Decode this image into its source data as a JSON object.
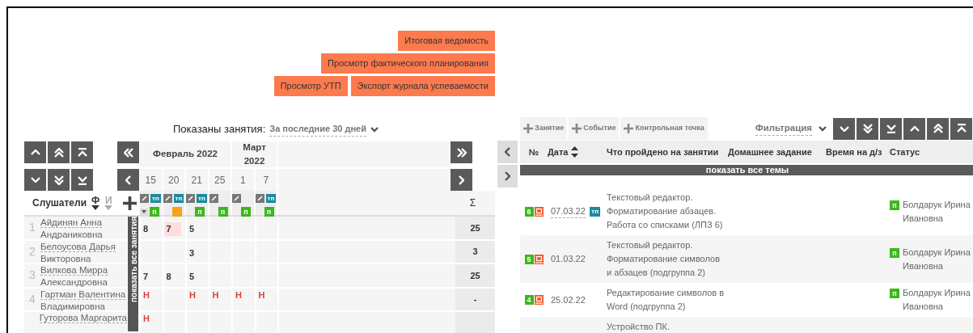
{
  "action_button_rows": [
    [
      "Итоговая ведомость"
    ],
    [
      "Просмотр фактического планирования"
    ],
    [
      "Просмотр УТП",
      "Экспорт журнала успеваемости"
    ]
  ],
  "journal": {
    "filter_label": "Показаны занятия:",
    "filter_value": "За последние 30 дней",
    "months": [
      {
        "label": "Февраль 2022",
        "days": [
          {
            "day": "15",
            "tp_badge": "тп",
            "lesson_type": {
              "kind": "practice",
              "label": "п"
            }
          },
          {
            "day": "20",
            "tp_badge": "тп",
            "lesson_type": {
              "kind": "event"
            }
          },
          {
            "day": "21",
            "tp_badge": "тп",
            "lesson_type": {
              "kind": "practice",
              "label": "п"
            }
          },
          {
            "day": "25",
            "lesson_type": {
              "kind": "practice",
              "label": "п"
            }
          }
        ]
      },
      {
        "label": "Март 2022",
        "days": [
          {
            "day": "1",
            "lesson_type": {
              "kind": "practice",
              "label": "п"
            }
          },
          {
            "day": "7",
            "tp_badge": "тп",
            "lesson_type": {
              "kind": "practice",
              "label": "п"
            }
          }
        ]
      }
    ],
    "students_label": "Слушатели",
    "sort_keys": [
      {
        "label": "Ф",
        "selected": true
      },
      {
        "label": "И",
        "selected": false
      }
    ],
    "sum_label": "Σ",
    "show_all_label": "показать все занятия",
    "students": [
      {
        "number": "1",
        "name": "Айдинян Анна",
        "patronymic": "Андраниковна",
        "grades": [
          {
            "value": "8",
            "kind": "grade",
            "highlighted": false
          },
          {
            "value": "7",
            "kind": "grade",
            "highlighted": true
          },
          {
            "value": "5",
            "kind": "grade",
            "highlighted": false
          },
          {
            "kind": "empty"
          },
          {
            "kind": "empty"
          },
          {
            "kind": "empty"
          }
        ],
        "total": "25"
      },
      {
        "number": "2",
        "name": "Белоусова Дарья",
        "patronymic": "Викторовна",
        "grades": [
          {
            "kind": "empty"
          },
          {
            "kind": "empty"
          },
          {
            "value": "3",
            "kind": "grade",
            "highlighted": false
          },
          {
            "kind": "empty"
          },
          {
            "kind": "empty"
          },
          {
            "kind": "empty"
          }
        ],
        "total": "3"
      },
      {
        "number": "3",
        "name": "Вилкова Мирра",
        "patronymic": "Александровна",
        "grades": [
          {
            "value": "7",
            "kind": "grade",
            "highlighted": false
          },
          {
            "value": "8",
            "kind": "grade",
            "highlighted": false
          },
          {
            "value": "5",
            "kind": "grade",
            "highlighted": false
          },
          {
            "kind": "empty"
          },
          {
            "kind": "empty"
          },
          {
            "kind": "empty"
          }
        ],
        "total": "25"
      },
      {
        "number": "4",
        "name": "Гартман Валентина",
        "patronymic": "Владимировна",
        "grades": [
          {
            "value": "Н",
            "kind": "absence",
            "highlighted": false
          },
          {
            "kind": "empty"
          },
          {
            "value": "Н",
            "kind": "absence",
            "highlighted": false
          },
          {
            "value": "Н",
            "kind": "absence",
            "highlighted": false
          },
          {
            "value": "Н",
            "kind": "absence",
            "highlighted": false
          },
          {
            "value": "Н",
            "kind": "absence",
            "highlighted": false
          }
        ],
        "total": "-"
      },
      {
        "name": "Гуторова Маргарита",
        "grades": [
          {
            "value": "Н",
            "kind": "absence",
            "highlighted": false
          },
          {
            "kind": "empty"
          },
          {
            "kind": "empty"
          },
          {
            "kind": "empty"
          },
          {
            "kind": "empty"
          },
          {
            "kind": "empty"
          }
        ]
      }
    ]
  },
  "lessons": {
    "add_buttons": [
      "Занятие",
      "Событие",
      "Контрольная точка"
    ],
    "filter_label": "Фильтрация",
    "columns": [
      "№",
      "Дата",
      "Что пройдено на занятии",
      "Домашнее задание",
      "Время на д/з",
      "Статус"
    ],
    "show_all_label": "показать все темы",
    "rows": [
      {
        "number": "6",
        "date": "07.03.22",
        "linked": true,
        "tp_badge": "тп",
        "topic_lines": [
          "Текстовый редактор.",
          "Форматирование абзацев.",
          "Работа со списками (ЛПЗ 6)"
        ],
        "status": "п",
        "teacher": "Болдарук Ирина Ивановна"
      },
      {
        "number": "5",
        "date": "01.03.22",
        "linked": false,
        "topic_lines": [
          "Текстовый редактор.",
          "Форматирование символов",
          "и абзацев (подгруппа 2)"
        ],
        "status": "п",
        "teacher": "Болдарук Ирина Ивановна"
      },
      {
        "number": "4",
        "date": "25.02.22",
        "linked": false,
        "topic_lines": [
          "Редактирование символов в",
          "Word (подгруппа 2)"
        ],
        "status": "п",
        "teacher": "Болдарук Ирина Ивановна"
      },
      {
        "topic_lines": [
          "Устройство ПК."
        ]
      }
    ]
  }
}
